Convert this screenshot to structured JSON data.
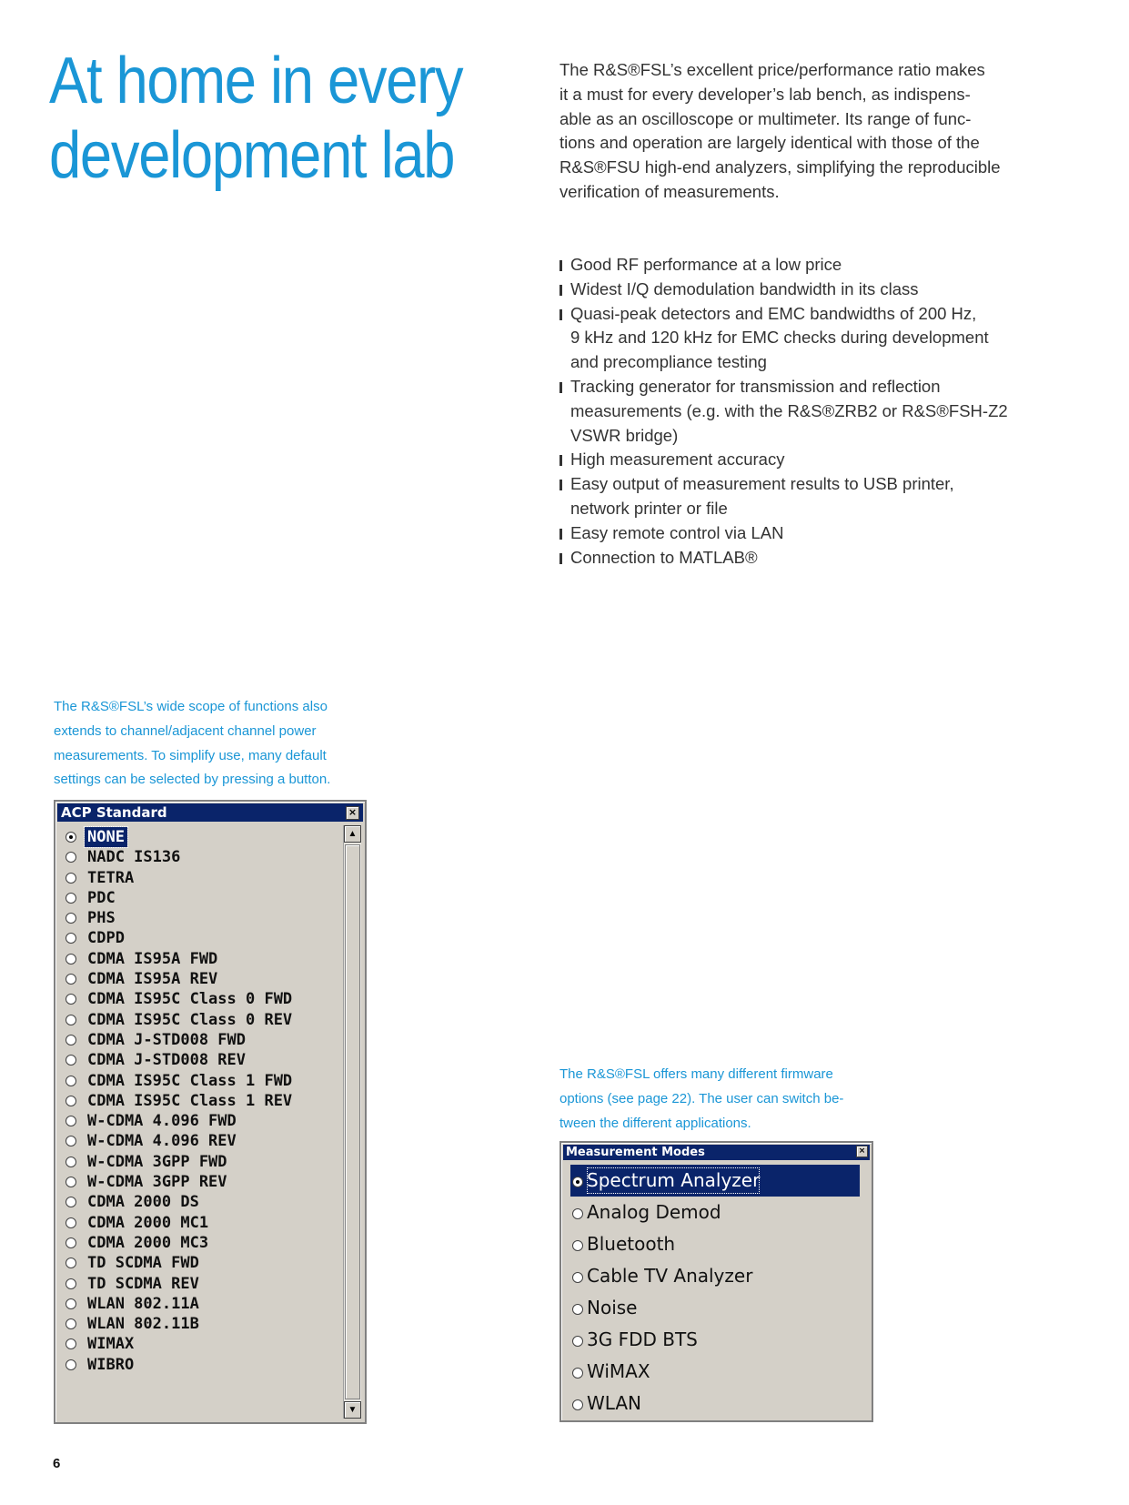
{
  "title": {
    "lines": [
      "At home in every",
      "development lab"
    ]
  },
  "intro": {
    "lines": [
      "The R&S®FSL’s excellent price/performance ratio makes",
      "it a must for every developer’s lab bench, as indispens-",
      "able as an oscilloscope or multimeter. Its range of func-",
      "tions and operation are largely identical with those of the",
      "R&S®FSU high-end analyzers, simplifying the reproducible",
      "verification of measurements."
    ]
  },
  "bullets": [
    {
      "lines": [
        "Good RF performance at a low price"
      ]
    },
    {
      "lines": [
        "Widest I/Q demodulation bandwidth in its class"
      ]
    },
    {
      "lines": [
        "Quasi-peak detectors and EMC bandwidths of 200 Hz,",
        "9 kHz and 120 kHz for EMC checks during development",
        "and precompliance testing"
      ]
    },
    {
      "lines": [
        "Tracking generator for transmission and reflection",
        "measurements (e.g. with the R&S®ZRB2 or R&S®FSH-Z2",
        "VSWR bridge)"
      ]
    },
    {
      "lines": [
        "High measurement accuracy"
      ]
    },
    {
      "lines": [
        "Easy output of measurement results to USB printer,",
        "network printer or file"
      ]
    },
    {
      "lines": [
        "Easy remote control via LAN"
      ]
    },
    {
      "lines": [
        "Connection to MATLAB®"
      ]
    }
  ],
  "caption_acp": {
    "lines": [
      "The R&S®FSL’s wide scope of functions also",
      "extends to channel/adjacent channel power",
      "measurements. To simplify use, many default",
      "settings can be selected by pressing a button."
    ]
  },
  "caption_modes": {
    "lines": [
      "The R&S®FSL offers many different firmware",
      "options (see page 22). The user can switch be-",
      "tween the different applications."
    ]
  },
  "acp_dialog": {
    "title": "ACP Standard",
    "close": "×",
    "scroll_up": "▲",
    "scroll_down": "▼",
    "items": [
      {
        "label": "NONE",
        "selected": true
      },
      {
        "label": "NADC IS136",
        "selected": false
      },
      {
        "label": "TETRA",
        "selected": false
      },
      {
        "label": "PDC",
        "selected": false
      },
      {
        "label": "PHS",
        "selected": false
      },
      {
        "label": "CDPD",
        "selected": false
      },
      {
        "label": "CDMA IS95A FWD",
        "selected": false
      },
      {
        "label": "CDMA IS95A REV",
        "selected": false
      },
      {
        "label": "CDMA IS95C Class 0 FWD",
        "selected": false
      },
      {
        "label": "CDMA IS95C Class 0 REV",
        "selected": false
      },
      {
        "label": "CDMA J-STD008 FWD",
        "selected": false
      },
      {
        "label": "CDMA J-STD008 REV",
        "selected": false
      },
      {
        "label": "CDMA IS95C Class 1 FWD",
        "selected": false
      },
      {
        "label": "CDMA IS95C Class 1 REV",
        "selected": false
      },
      {
        "label": "W-CDMA 4.096 FWD",
        "selected": false
      },
      {
        "label": "W-CDMA 4.096 REV",
        "selected": false
      },
      {
        "label": "W-CDMA 3GPP FWD",
        "selected": false
      },
      {
        "label": "W-CDMA 3GPP REV",
        "selected": false
      },
      {
        "label": "CDMA 2000 DS",
        "selected": false
      },
      {
        "label": "CDMA 2000 MC1",
        "selected": false
      },
      {
        "label": "CDMA 2000 MC3",
        "selected": false
      },
      {
        "label": "TD SCDMA FWD",
        "selected": false
      },
      {
        "label": "TD SCDMA REV",
        "selected": false
      },
      {
        "label": "WLAN 802.11A",
        "selected": false
      },
      {
        "label": "WLAN 802.11B",
        "selected": false
      },
      {
        "label": "WIMAX",
        "selected": false
      },
      {
        "label": "WIBRO",
        "selected": false
      }
    ]
  },
  "modes_dialog": {
    "title": "Measurement Modes",
    "close": "×",
    "items": [
      {
        "label": "Spectrum Analyzer",
        "selected": true
      },
      {
        "label": "Analog Demod",
        "selected": false
      },
      {
        "label": "Bluetooth",
        "selected": false
      },
      {
        "label": "Cable TV Analyzer",
        "selected": false
      },
      {
        "label": "Noise",
        "selected": false
      },
      {
        "label": "3G FDD BTS",
        "selected": false
      },
      {
        "label": "WiMAX",
        "selected": false
      },
      {
        "label": "WLAN",
        "selected": false
      }
    ]
  },
  "page_number": "6",
  "colors": {
    "accent": "#1a96d6",
    "dialog_bg": "#d4d0c8",
    "titlebar": "#0a246a"
  }
}
